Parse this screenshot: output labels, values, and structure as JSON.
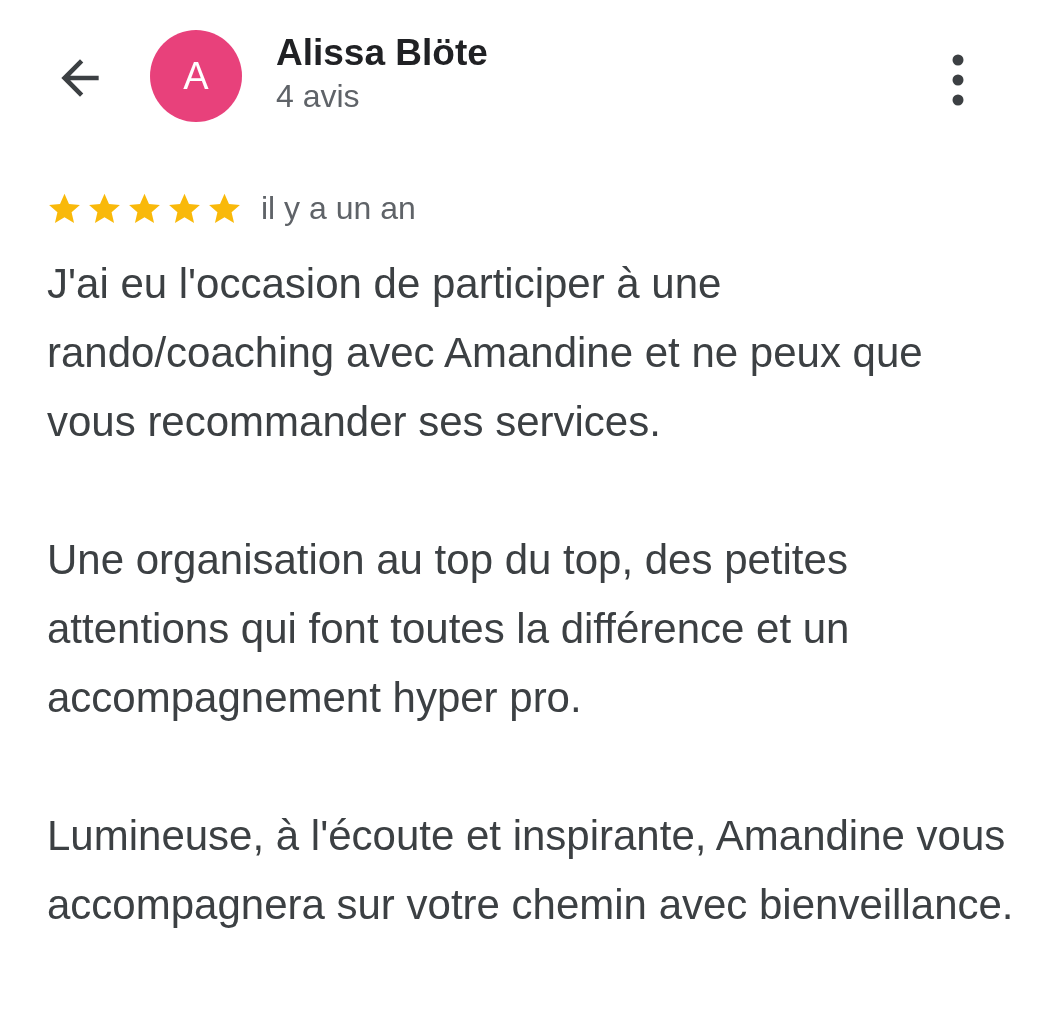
{
  "header": {
    "avatar_letter": "A",
    "name": "Alissa Blöte",
    "review_count": "4 avis"
  },
  "review": {
    "stars": 5,
    "time": "il y a un an",
    "paragraphs": [
      "J'ai eu l'occasion de participer à une rando/coaching avec Amandine et ne peux que vous recommander ses services.",
      "Une organisation au top du top, des petites attentions qui font toutes la différence et un accompagnement hyper pro.",
      "Lumineuse, à l'écoute et inspirante, Amandine vous accompagnera sur votre chemin avec bienveillance."
    ]
  }
}
